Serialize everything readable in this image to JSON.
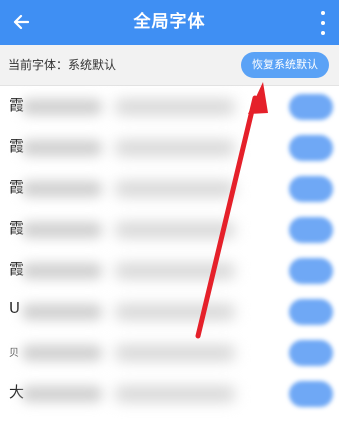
{
  "header": {
    "title": "全局字体",
    "back_icon": "arrow-left-icon",
    "menu_icon": "more-vertical-icon"
  },
  "current_font": {
    "label": "当前字体：系统默认",
    "restore_button": "恢复系统默认"
  },
  "font_list": {
    "rows": [
      {
        "icon_text": "霞"
      },
      {
        "icon_text": "霞"
      },
      {
        "icon_text": "霞"
      },
      {
        "icon_text": "霞"
      },
      {
        "icon_text": "霞"
      },
      {
        "icon_text": "U"
      },
      {
        "icon_text": "贝"
      },
      {
        "icon_text": "大"
      }
    ]
  },
  "colors": {
    "header_bg": "#3f8ff3",
    "restore_button_bg": "#5aa2f6",
    "annotation_arrow": "#e5202a"
  }
}
